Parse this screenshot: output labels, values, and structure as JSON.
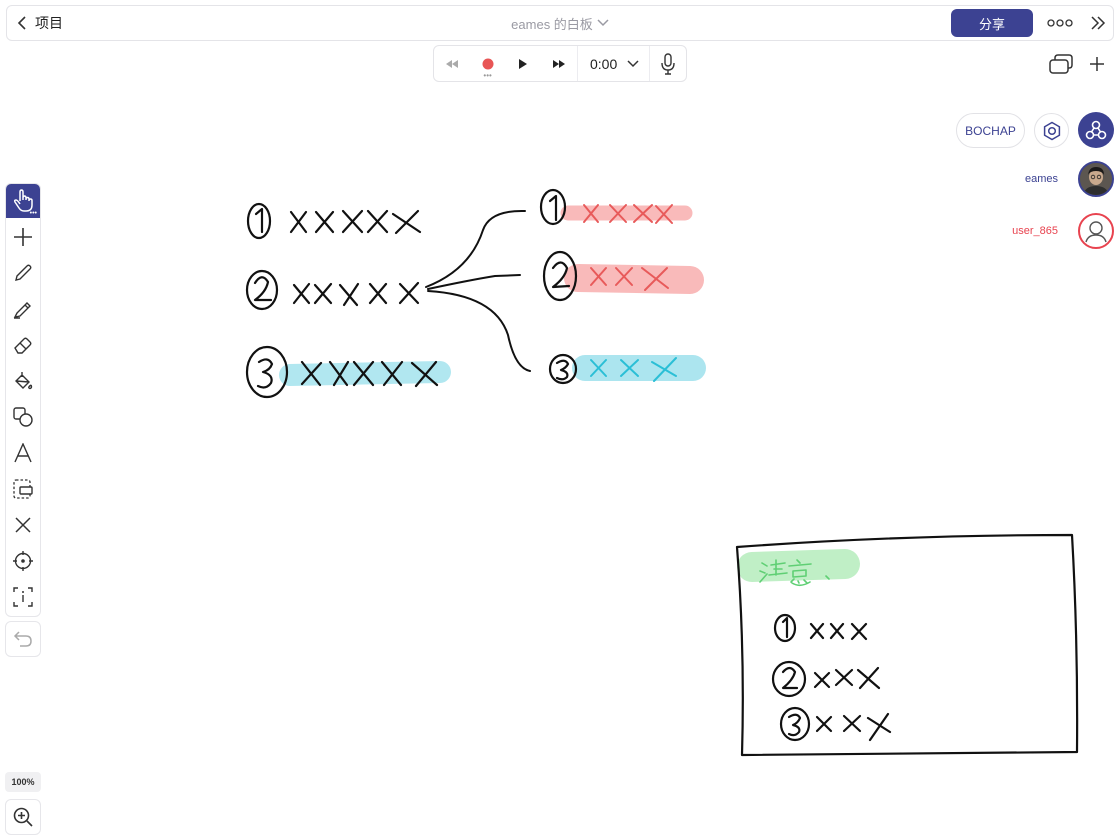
{
  "topbar": {
    "back_label": "项目",
    "title": "eames 的白板",
    "share_label": "分享"
  },
  "player": {
    "time": "0:00"
  },
  "collaboration": {
    "workspace_label": "BOCHAP",
    "users": [
      {
        "name": "eames",
        "color": "#3c4292"
      },
      {
        "name": "user_865",
        "color": "#e8434f"
      }
    ]
  },
  "zoom": {
    "level": "100%"
  },
  "colors": {
    "accent": "#3c4292",
    "record": "#e85555",
    "highlight_red": "#f9b6b6",
    "highlight_cyan": "#a8e4ee",
    "highlight_green": "#bdeec3"
  },
  "toolbar": {
    "tools": [
      "hand-icon",
      "plus-icon",
      "pen-icon",
      "marker-icon",
      "eraser-icon",
      "fill-icon",
      "shapes-icon",
      "text-icon",
      "frame-icon",
      "cross-icon",
      "target-icon",
      "select-text-icon"
    ]
  }
}
